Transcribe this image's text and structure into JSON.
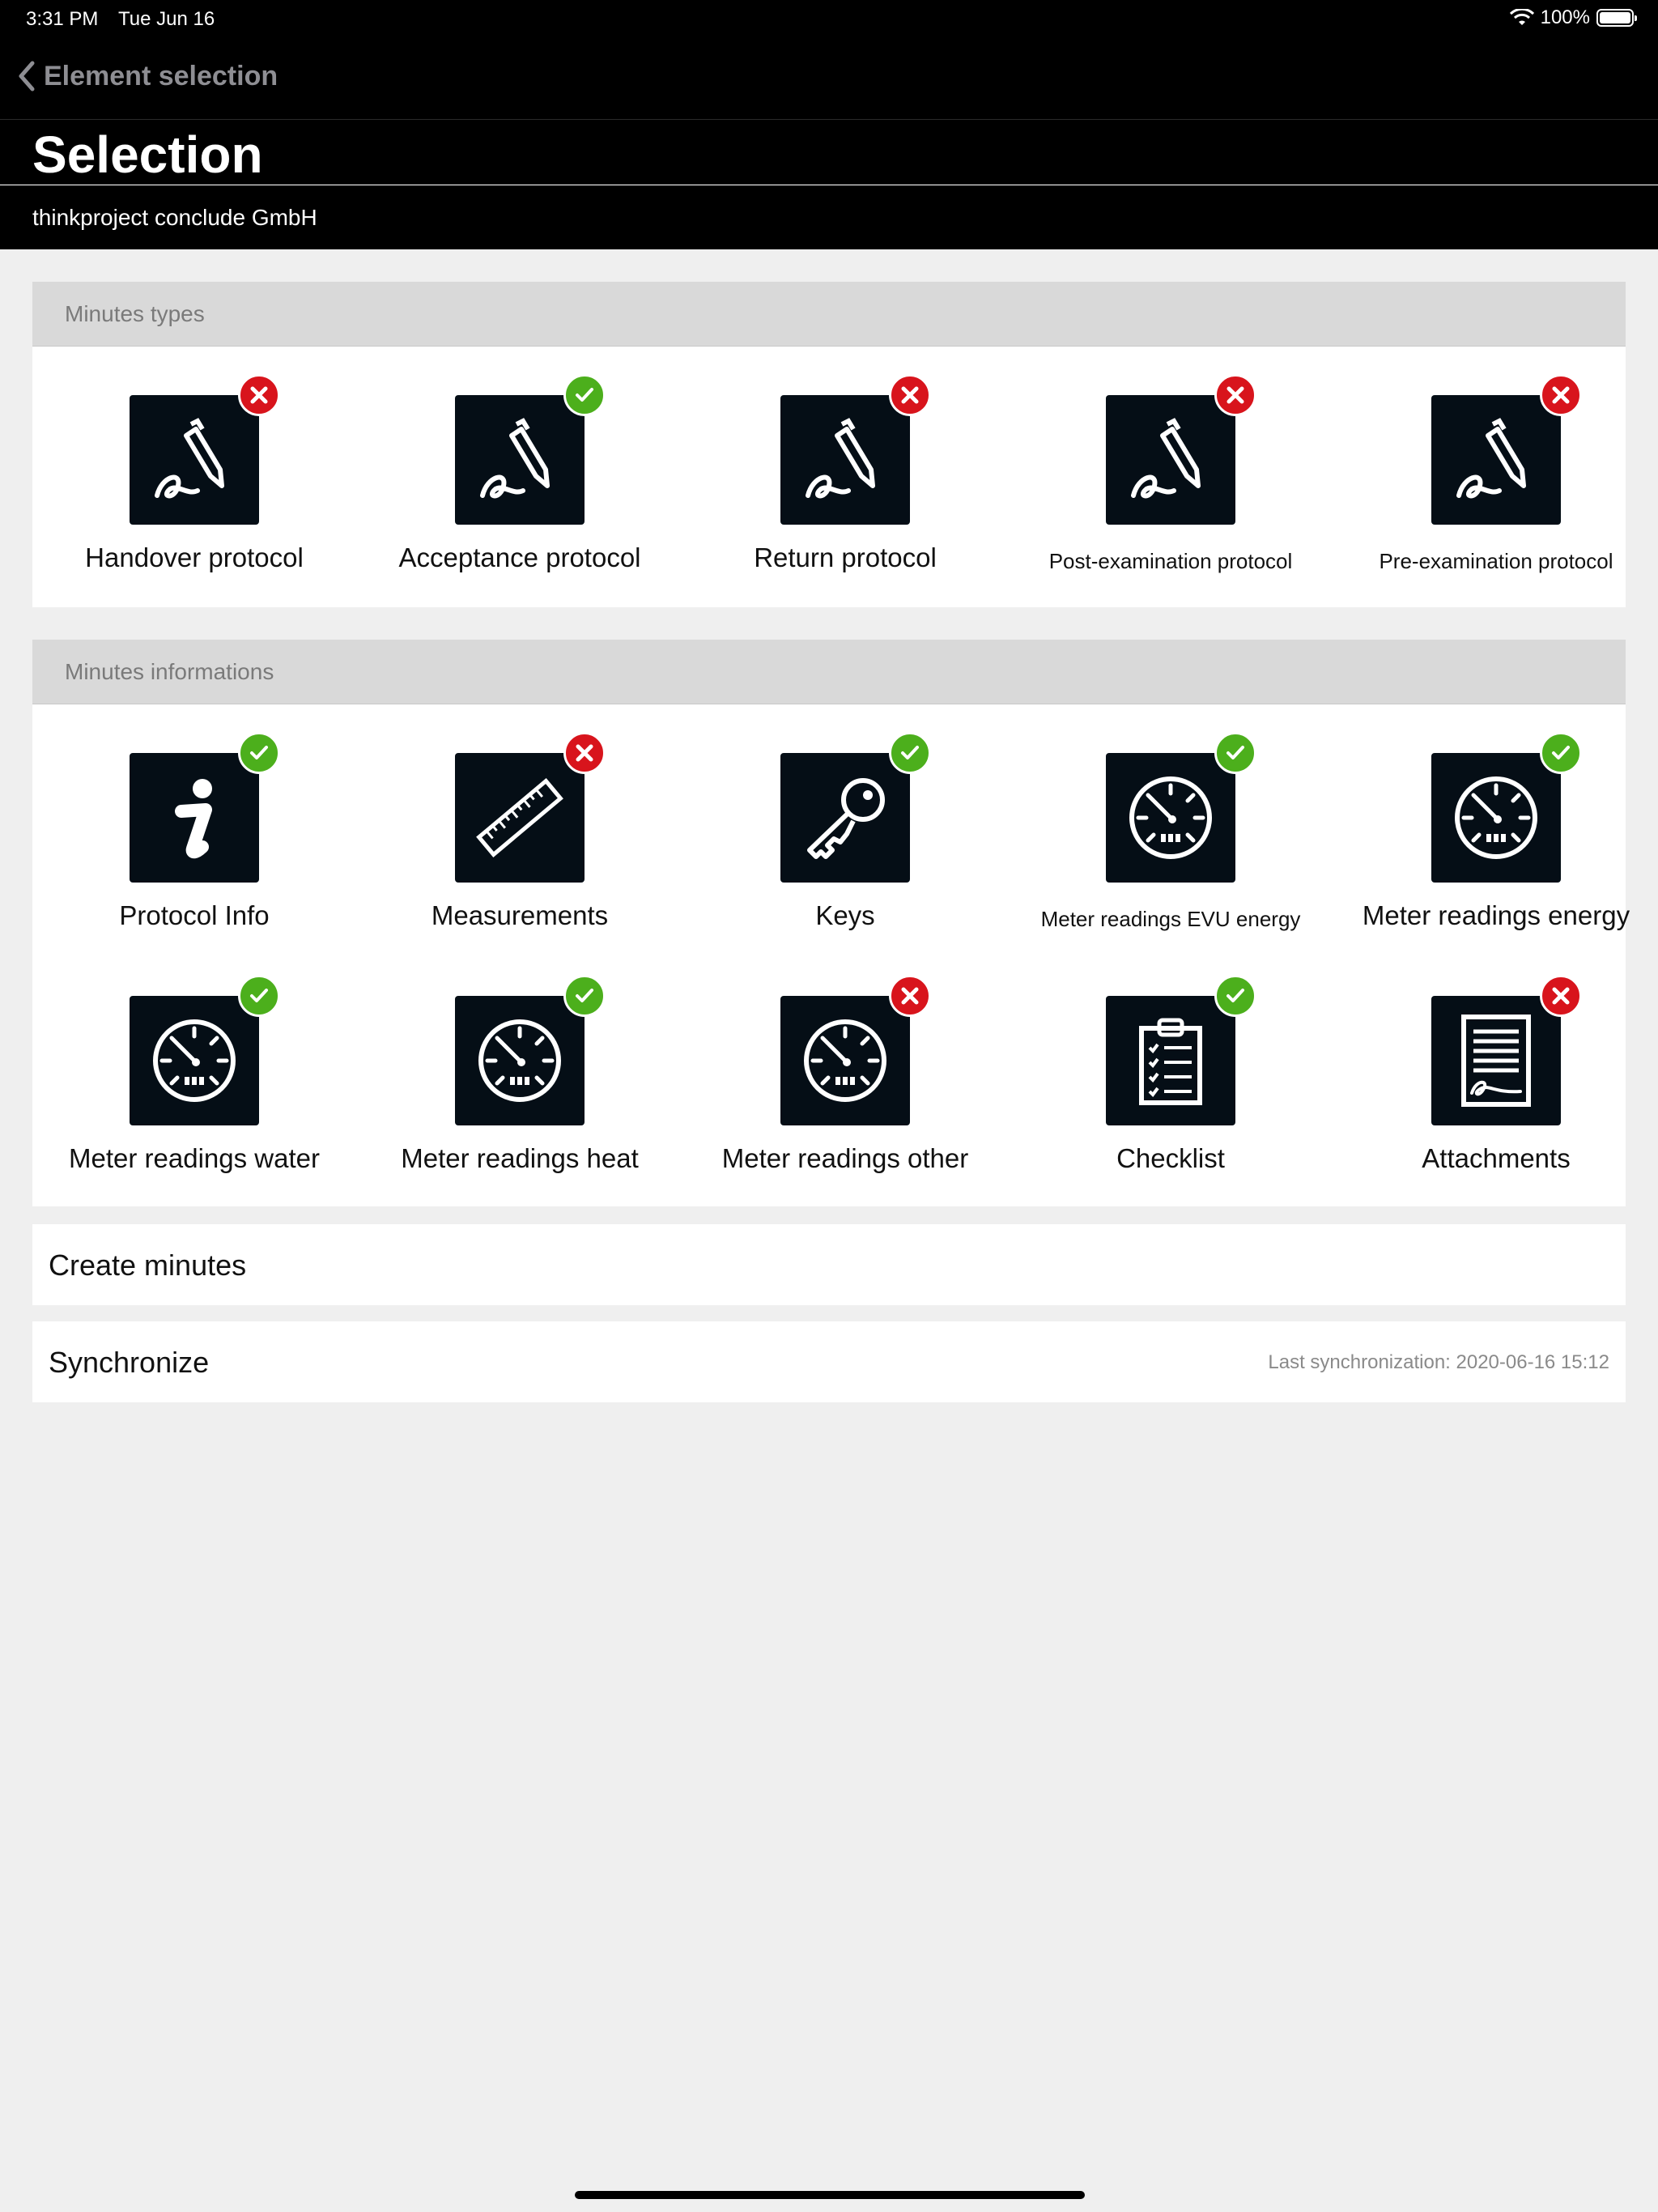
{
  "status": {
    "time": "3:31 PM",
    "date": "Tue Jun 16",
    "battery": "100%"
  },
  "nav": {
    "back_label": "Element selection"
  },
  "page": {
    "title": "Selection",
    "company": "thinkproject conclude GmbH"
  },
  "minutes_types": {
    "header": "Minutes types",
    "items": [
      {
        "label": "Handover protocol",
        "icon": "signature-pen-icon",
        "status": "no"
      },
      {
        "label": "Acceptance protocol",
        "icon": "signature-pen-icon",
        "status": "ok"
      },
      {
        "label": "Return protocol",
        "icon": "signature-pen-icon",
        "status": "no"
      },
      {
        "label": "Post-examination protocol",
        "icon": "signature-pen-icon",
        "status": "no"
      },
      {
        "label": "Pre-examination protocol",
        "icon": "signature-pen-icon",
        "status": "no"
      }
    ]
  },
  "minutes_info": {
    "header": "Minutes informations",
    "items": [
      {
        "label": "Protocol Info",
        "icon": "info-icon",
        "status": "ok"
      },
      {
        "label": "Measurements",
        "icon": "ruler-icon",
        "status": "no"
      },
      {
        "label": "Keys",
        "icon": "key-icon",
        "status": "ok"
      },
      {
        "label": "Meter readings EVU energy",
        "icon": "gauge-icon",
        "status": "ok"
      },
      {
        "label": "Meter readings energy",
        "icon": "gauge-icon",
        "status": "ok"
      },
      {
        "label": "Meter readings water",
        "icon": "gauge-icon",
        "status": "ok"
      },
      {
        "label": "Meter readings heat",
        "icon": "gauge-icon",
        "status": "ok"
      },
      {
        "label": "Meter readings other",
        "icon": "gauge-icon",
        "status": "no"
      },
      {
        "label": "Checklist",
        "icon": "clipboard-checklist-icon",
        "status": "ok"
      },
      {
        "label": "Attachments",
        "icon": "document-attachment-icon",
        "status": "no"
      }
    ]
  },
  "actions": {
    "create_label": "Create minutes",
    "sync_label": "Synchronize",
    "last_sync": "Last synchronization: 2020-06-16 15:12"
  },
  "colors": {
    "ok": "#4caf1c",
    "no": "#d8141c",
    "tile": "#050e16"
  }
}
